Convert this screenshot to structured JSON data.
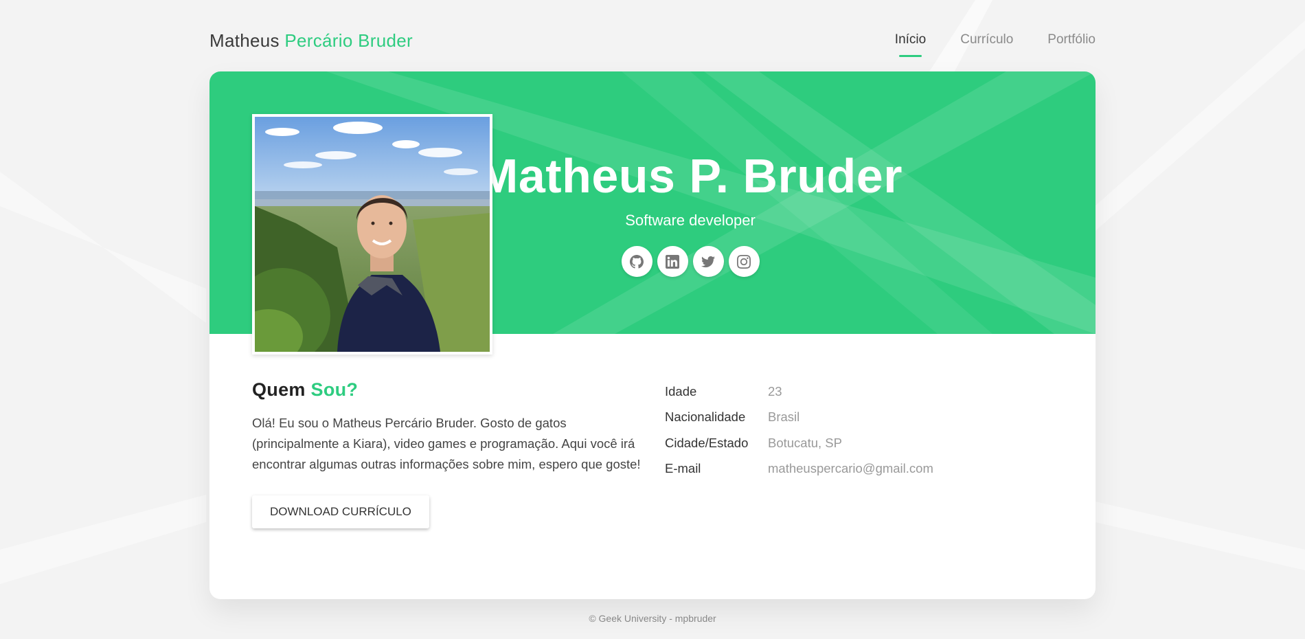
{
  "header": {
    "brand_first": "Matheus",
    "brand_rest": "Percário Bruder",
    "nav": [
      {
        "label": "Início",
        "active": true
      },
      {
        "label": "Currículo",
        "active": false
      },
      {
        "label": "Portfólio",
        "active": false
      }
    ]
  },
  "hero": {
    "name": "Matheus P. Bruder",
    "role": "Software developer",
    "socials": [
      "github-icon",
      "linkedin-icon",
      "twitter-icon",
      "instagram-icon"
    ]
  },
  "about": {
    "title_first": "Quem",
    "title_accent": "Sou?",
    "text": "Olá! Eu sou o Matheus Percário Bruder. Gosto de gatos (principalmente a Kiara), video games e programação. Aqui você irá encontrar algumas outras informações sobre mim, espero que goste!",
    "download_label": "DOWNLOAD CURRÍCULO"
  },
  "info": [
    {
      "key": "Idade",
      "value": "23"
    },
    {
      "key": "Nacionalidade",
      "value": "Brasil"
    },
    {
      "key": "Cidade/Estado",
      "value": "Botucatu, SP"
    },
    {
      "key": "E-mail",
      "value": "matheuspercario@gmail.com"
    }
  ],
  "footer": "© Geek University - mpbruder",
  "colors": {
    "accent": "#2ecc80",
    "hero_bg": "#2ecc7e",
    "page_bg": "#f3f3f3"
  }
}
